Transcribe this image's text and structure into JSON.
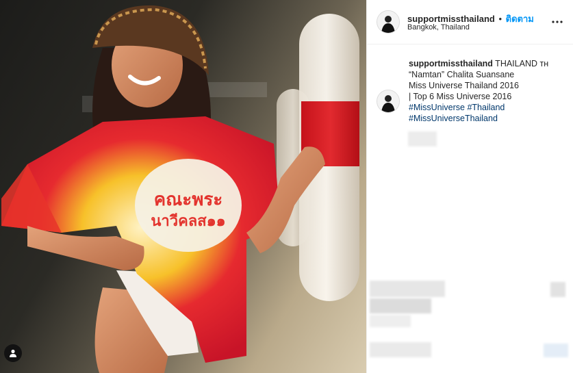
{
  "post": {
    "username": "supportmissthailand",
    "separator": "•",
    "follow_label": "ติดตาม",
    "location": "Bangkok, Thailand",
    "more_icon": "more-horizontal-icon"
  },
  "caption": {
    "username": "supportmissthailand",
    "line1_rest": " THAILAND ᴛʜ",
    "line2": "“Namtan” Chalita Suansane",
    "line3": "Miss Universe Thailand 2016",
    "line4": "| Top 6 Miss Universe 2016",
    "hashtag1": "#MissUniverse",
    "hashtag2": "#Thailand",
    "hashtag3": "#MissUniverseThailand"
  },
  "photo": {
    "shirt_text_line1": "คณะพระ",
    "shirt_text_line2": "นาวีคลส๑๑",
    "user_tag_icon": "user-tag-icon"
  }
}
